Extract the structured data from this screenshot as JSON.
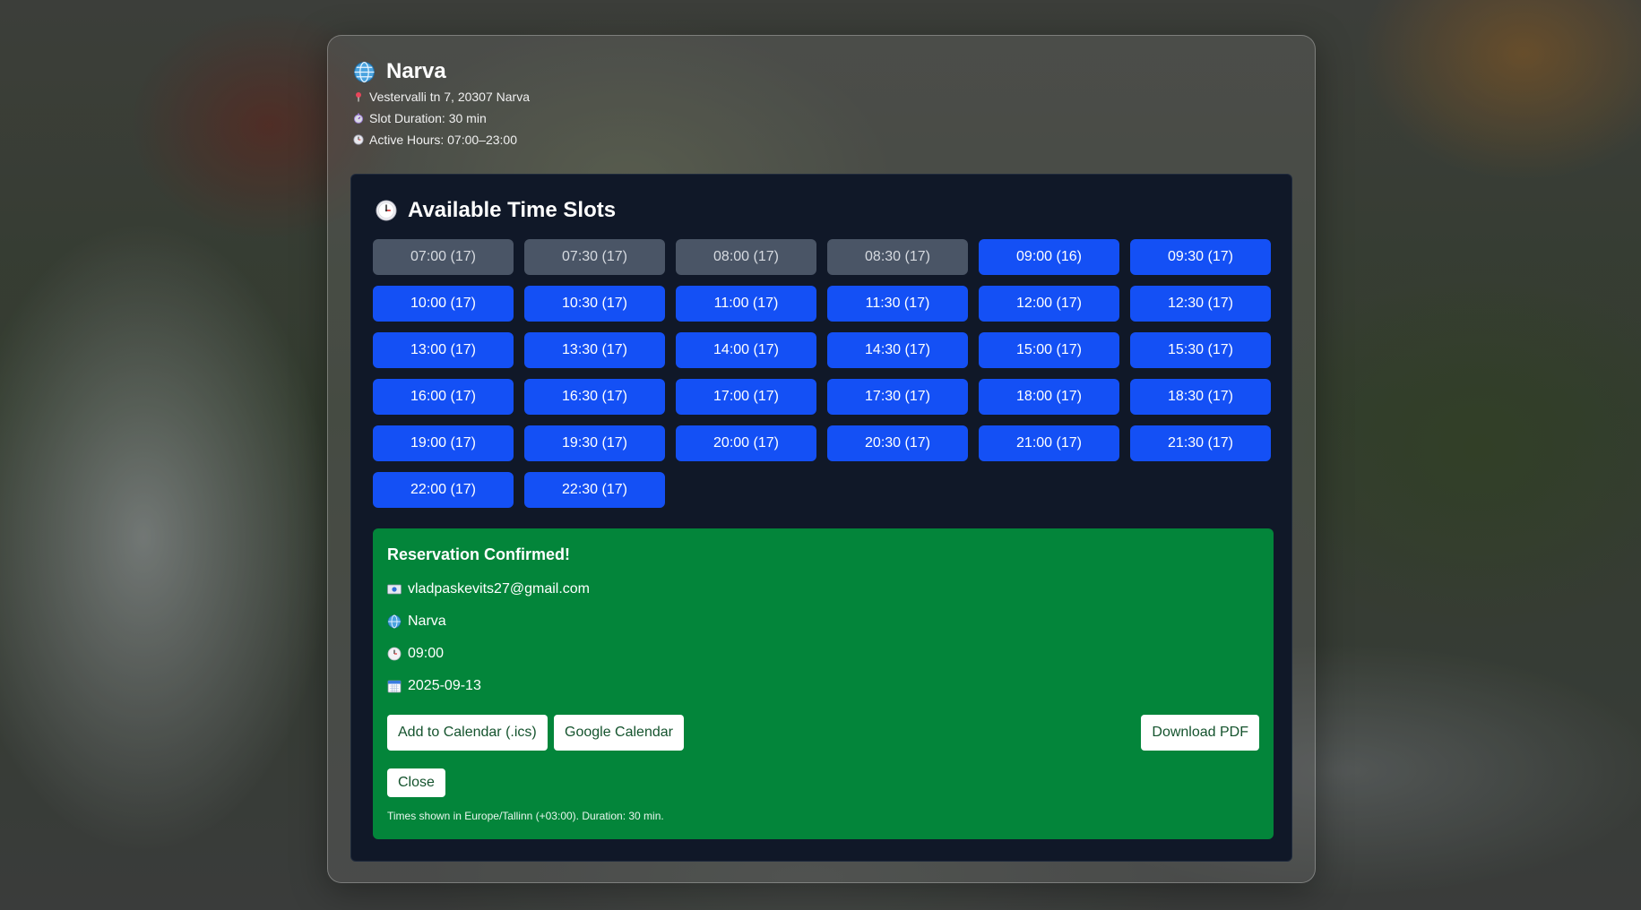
{
  "location": {
    "name": "Narva",
    "address": "Vestervalli tn 7, 20307 Narva",
    "slot_duration": "Slot Duration: 30 min",
    "active_hours": "Active Hours: 07:00–23:00"
  },
  "slots": {
    "heading": "Available Time Slots",
    "items": [
      {
        "label": "07:00 (17)",
        "state": "past"
      },
      {
        "label": "07:30 (17)",
        "state": "past"
      },
      {
        "label": "08:00 (17)",
        "state": "past"
      },
      {
        "label": "08:30 (17)",
        "state": "past"
      },
      {
        "label": "09:00 (16)",
        "state": "available"
      },
      {
        "label": "09:30 (17)",
        "state": "available"
      },
      {
        "label": "10:00 (17)",
        "state": "available"
      },
      {
        "label": "10:30 (17)",
        "state": "available"
      },
      {
        "label": "11:00 (17)",
        "state": "available"
      },
      {
        "label": "11:30 (17)",
        "state": "available"
      },
      {
        "label": "12:00 (17)",
        "state": "available"
      },
      {
        "label": "12:30 (17)",
        "state": "available"
      },
      {
        "label": "13:00 (17)",
        "state": "available"
      },
      {
        "label": "13:30 (17)",
        "state": "available"
      },
      {
        "label": "14:00 (17)",
        "state": "available"
      },
      {
        "label": "14:30 (17)",
        "state": "available"
      },
      {
        "label": "15:00 (17)",
        "state": "available"
      },
      {
        "label": "15:30 (17)",
        "state": "available"
      },
      {
        "label": "16:00 (17)",
        "state": "available"
      },
      {
        "label": "16:30 (17)",
        "state": "available"
      },
      {
        "label": "17:00 (17)",
        "state": "available"
      },
      {
        "label": "17:30 (17)",
        "state": "available"
      },
      {
        "label": "18:00 (17)",
        "state": "available"
      },
      {
        "label": "18:30 (17)",
        "state": "available"
      },
      {
        "label": "19:00 (17)",
        "state": "available"
      },
      {
        "label": "19:30 (17)",
        "state": "available"
      },
      {
        "label": "20:00 (17)",
        "state": "available"
      },
      {
        "label": "20:30 (17)",
        "state": "available"
      },
      {
        "label": "21:00 (17)",
        "state": "available"
      },
      {
        "label": "21:30 (17)",
        "state": "available"
      },
      {
        "label": "22:00 (17)",
        "state": "available"
      },
      {
        "label": "22:30 (17)",
        "state": "available"
      }
    ]
  },
  "confirmation": {
    "title": "Reservation Confirmed!",
    "email": "vladpaskevits27@gmail.com",
    "location": "Narva",
    "time": "09:00",
    "date": "2025-09-13",
    "add_ics_label": "Add to Calendar (.ics)",
    "google_label": "Google Calendar",
    "download_pdf_label": "Download PDF",
    "close_label": "Close",
    "note": "Times shown in Europe/Tallinn (+03:00). Duration: 30 min."
  },
  "colors": {
    "slot_available": "#1450f5",
    "slot_past": "#4a5566",
    "card_bg": "#101828",
    "confirm_bg": "#03853a"
  },
  "icons": {
    "title": "globe-icon",
    "address": "pin-icon",
    "duration": "stopwatch-icon",
    "hours": "clock-icon",
    "heading": "clock-icon",
    "email": "envelope-icon",
    "location": "globe-icon",
    "time": "clock-icon",
    "date": "calendar-icon"
  }
}
